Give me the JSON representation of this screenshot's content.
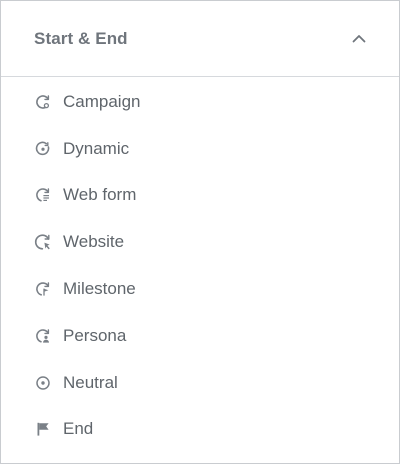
{
  "section": {
    "title": "Start & End",
    "collapse_icon": "chevron-up-icon"
  },
  "items": [
    {
      "label": "Campaign",
      "icon": "campaign-icon"
    },
    {
      "label": "Dynamic",
      "icon": "dynamic-icon"
    },
    {
      "label": "Web form",
      "icon": "web-form-icon"
    },
    {
      "label": "Website",
      "icon": "website-icon"
    },
    {
      "label": "Milestone",
      "icon": "milestone-icon"
    },
    {
      "label": "Persona",
      "icon": "persona-icon"
    },
    {
      "label": "Neutral",
      "icon": "neutral-icon"
    },
    {
      "label": "End",
      "icon": "flag-icon"
    }
  ],
  "colors": {
    "text": "#5f656b",
    "title": "#6f757c",
    "icon": "#7a8087",
    "border": "#c9ccd0"
  }
}
